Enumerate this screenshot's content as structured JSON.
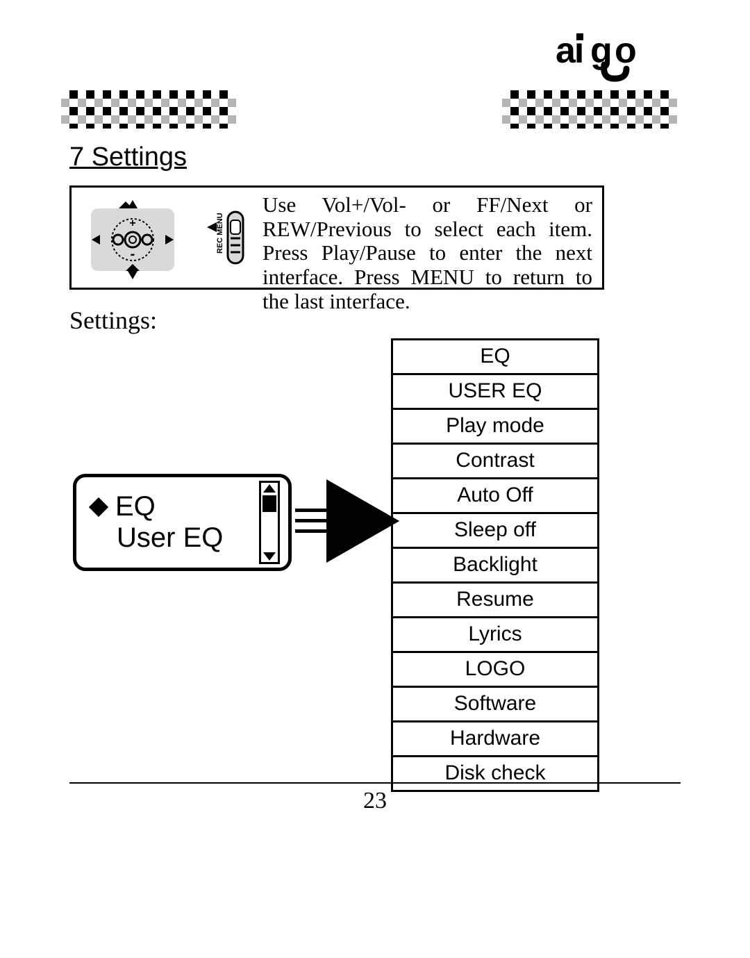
{
  "brand": "aigo",
  "section_heading": "7 Settings",
  "instruction_text": "Use Vol+/Vol- or FF/Next or REW/Previous to select each item. Press Play/Pause to enter the next interface. Press MENU to return to the last interface.",
  "settings_label": "Settings:",
  "lcd": {
    "line1": "EQ",
    "line2": "User EQ"
  },
  "settings_items": [
    "EQ",
    "USER  EQ",
    "Play  mode",
    "Contrast",
    "Auto  Off",
    "Sleep  off",
    "Backlight",
    "Resume",
    "Lyrics",
    "LOGO",
    "Software",
    "Hardware",
    "Disk  check"
  ],
  "page_number": "23"
}
